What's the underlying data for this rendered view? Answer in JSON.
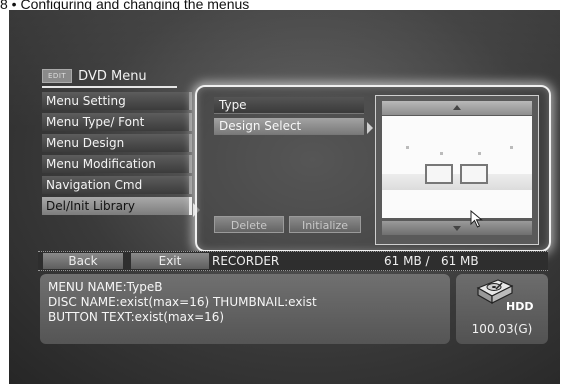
{
  "caption_fragment": "8 • Configuring and changing the menus",
  "title": {
    "badge": "EDIT",
    "text": "DVD Menu"
  },
  "left_menu": {
    "items": [
      {
        "label": "Menu Setting"
      },
      {
        "label": "Menu Type/ Font"
      },
      {
        "label": "Menu Design"
      },
      {
        "label": "Menu Modification"
      },
      {
        "label": "Navigation Cmd"
      },
      {
        "label": "Del/Init Library",
        "active": true
      }
    ]
  },
  "sub_menu": {
    "items": [
      {
        "label": "Type"
      },
      {
        "label": "Design Select",
        "active": true
      }
    ]
  },
  "actions": {
    "delete_label": "Delete",
    "initialize_label": "Initialize"
  },
  "status_bar": {
    "back_label": "Back",
    "exit_label": "Exit",
    "source": "RECORDER",
    "capacity": "61 MB /   61 MB"
  },
  "info": {
    "lines": [
      "MENU NAME:TypeB",
      "DISC NAME:exist(max=16)  THUMBNAIL:exist",
      "BUTTON TEXT:exist(max=16)"
    ]
  },
  "hdd": {
    "label": "HDD",
    "size": "100.03(G)",
    "icon": "hdd-icon"
  },
  "colors": {
    "highlight": "#a3a3a3",
    "panel_glow": "#f0f0f0",
    "background": "#3a3a3a"
  }
}
